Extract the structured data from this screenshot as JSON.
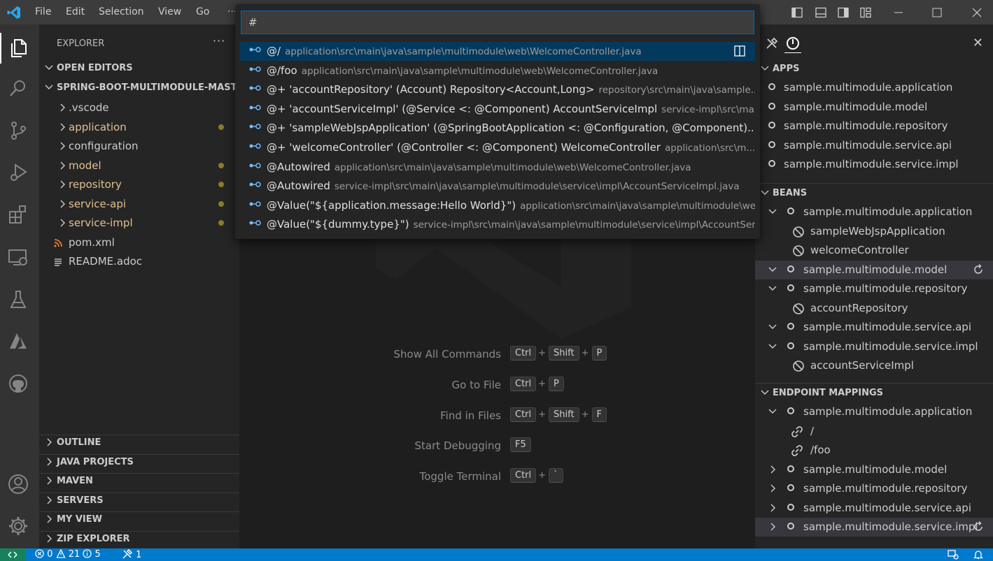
{
  "menu": [
    "File",
    "Edit",
    "Selection",
    "View",
    "Go",
    "···"
  ],
  "sidebar": {
    "title": "EXPLORER",
    "more": "···",
    "open_editors": "OPEN EDITORS",
    "project": "SPRING-BOOT-MULTIMODULE-MASTER",
    "files": [
      {
        "label": ".vscode",
        "kind": "folder",
        "modified": false
      },
      {
        "label": "application",
        "kind": "folder",
        "modified": true
      },
      {
        "label": "configuration",
        "kind": "folder",
        "modified": false
      },
      {
        "label": "model",
        "kind": "folder",
        "modified": true
      },
      {
        "label": "repository",
        "kind": "folder",
        "modified": true
      },
      {
        "label": "service-api",
        "kind": "folder",
        "modified": true
      },
      {
        "label": "service-impl",
        "kind": "folder",
        "modified": true
      },
      {
        "label": "pom.xml",
        "kind": "rss-icon",
        "modified": false
      },
      {
        "label": "README.adoc",
        "kind": "lines-icon",
        "modified": false
      }
    ],
    "bottom_sections": [
      "OUTLINE",
      "JAVA PROJECTS",
      "MAVEN",
      "SERVERS",
      "MY VIEW",
      "ZIP EXPLORER"
    ]
  },
  "quickpick": {
    "input_value": "#",
    "items": [
      {
        "label": "@/",
        "desc": "application\\src\\main\\java\\sample\\multimodule\\web\\WelcomeController.java",
        "selected": true
      },
      {
        "label": "@/foo",
        "desc": "application\\src\\main\\java\\sample\\multimodule\\web\\WelcomeController.java",
        "selected": false
      },
      {
        "label": "@+ 'accountRepository' (Account) Repository<Account,Long>",
        "desc": "repository\\src\\main\\java\\sample...",
        "selected": false
      },
      {
        "label": "@+ 'accountServiceImpl' (@Service <: @Component) AccountServiceImpl",
        "desc": "service-impl\\src\\ma...",
        "selected": false
      },
      {
        "label": "@+ 'sampleWebJspApplication' (@SpringBootApplication <: @Configuration, @Component)...",
        "desc": "",
        "selected": false
      },
      {
        "label": "@+ 'welcomeController' (@Controller <: @Component) WelcomeController",
        "desc": "application\\src\\m...",
        "selected": false
      },
      {
        "label": "@Autowired",
        "desc": "application\\src\\main\\java\\sample\\multimodule\\web\\WelcomeController.java",
        "selected": false
      },
      {
        "label": "@Autowired",
        "desc": "service-impl\\src\\main\\java\\sample\\multimodule\\service\\impl\\AccountServiceImpl.java",
        "selected": false
      },
      {
        "label": "@Value(\"${application.message:Hello World}\")",
        "desc": "application\\src\\main\\java\\sample\\multimodule\\we...",
        "selected": false
      },
      {
        "label": "@Value(\"${dummy.type}\")",
        "desc": "service-impl\\src\\main\\java\\sample\\multimodule\\service\\impl\\AccountSer...",
        "selected": false
      }
    ]
  },
  "shortcuts": [
    {
      "name": "Show All Commands",
      "keys": [
        "Ctrl",
        "Shift",
        "P"
      ]
    },
    {
      "name": "Go to File",
      "keys": [
        "Ctrl",
        "P"
      ]
    },
    {
      "name": "Find in Files",
      "keys": [
        "Ctrl",
        "Shift",
        "F"
      ]
    },
    {
      "name": "Start Debugging",
      "keys": [
        "F5"
      ]
    },
    {
      "name": "Toggle Terminal",
      "keys": [
        "Ctrl",
        "`"
      ]
    }
  ],
  "rightpanel": {
    "close": "✕",
    "apps_header": "APPS",
    "apps": [
      "sample.multimodule.application",
      "sample.multimodule.model",
      "sample.multimodule.repository",
      "sample.multimodule.service.api",
      "sample.multimodule.service.impl"
    ],
    "beans_header": "BEANS",
    "beans": [
      {
        "label": "sample.multimodule.application",
        "level": 0,
        "expanded": true
      },
      {
        "label": "sampleWebJspApplication",
        "level": 1
      },
      {
        "label": "welcomeController",
        "level": 1
      },
      {
        "label": "sample.multimodule.model",
        "level": 0,
        "expanded": true,
        "highlight": true,
        "refresh": true
      },
      {
        "label": "sample.multimodule.repository",
        "level": 0,
        "expanded": true
      },
      {
        "label": "accountRepository",
        "level": 1
      },
      {
        "label": "sample.multimodule.service.api",
        "level": 0,
        "expanded": true
      },
      {
        "label": "sample.multimodule.service.impl",
        "level": 0,
        "expanded": true
      },
      {
        "label": "accountServiceImpl",
        "level": 1
      }
    ],
    "endpoints_header": "ENDPOINT MAPPINGS",
    "endpoints": [
      {
        "label": "sample.multimodule.application",
        "level": 0,
        "expanded": true
      },
      {
        "label": "/",
        "level": 1
      },
      {
        "label": "/foo",
        "level": 1
      },
      {
        "label": "sample.multimodule.model",
        "level": 0,
        "expanded": false
      },
      {
        "label": "sample.multimodule.repository",
        "level": 0,
        "expanded": false
      },
      {
        "label": "sample.multimodule.service.api",
        "level": 0,
        "expanded": false
      },
      {
        "label": "sample.multimodule.service.impl",
        "level": 0,
        "expanded": false,
        "highlight": true,
        "refresh": true
      }
    ]
  },
  "status": {
    "errors": "0",
    "warnings": "21",
    "infos": "5",
    "tools": "1"
  },
  "colors": {
    "accent": "#007acc",
    "modified": "#e2c08d",
    "selection": "#04395e"
  }
}
